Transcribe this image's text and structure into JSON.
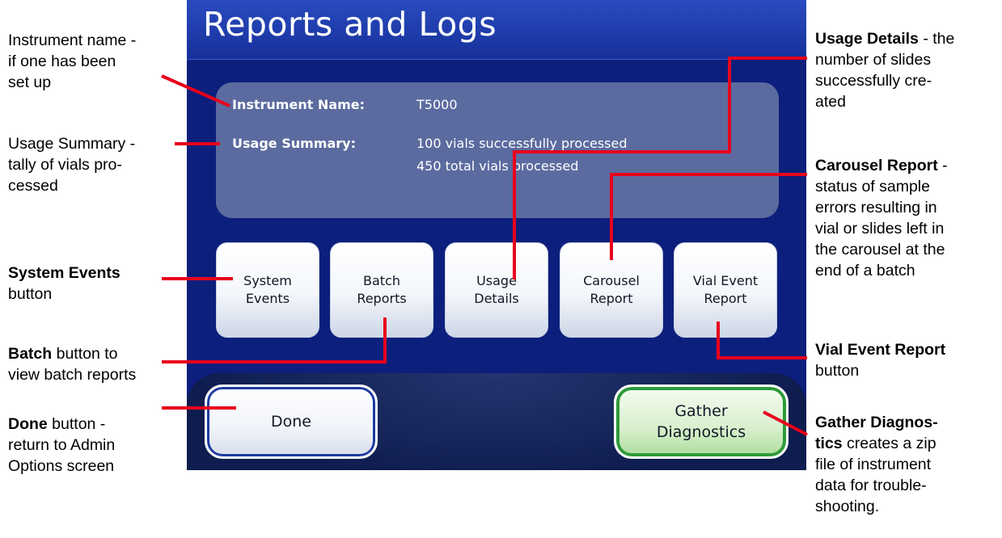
{
  "screen": {
    "title": "Reports and Logs",
    "info": {
      "instrument_name_label": "Instrument Name:",
      "instrument_name_value": "T5000",
      "usage_summary_label": "Usage Summary:",
      "usage_summary_line1": "100 vials successfully processed",
      "usage_summary_line2": "450 total vials processed"
    },
    "buttons": {
      "system_events": "System\nEvents",
      "batch_reports": "Batch\nReports",
      "usage_details": "Usage\nDetails",
      "carousel_report": "Carousel\nReport",
      "vial_event_report": "Vial Event\nReport"
    },
    "done": "Done",
    "gather_diagnostics": "Gather\nDiagnostics"
  },
  "annotations": {
    "instrument_name": {
      "lines": [
        "Instrument name -",
        "if one has been",
        "set up"
      ]
    },
    "usage_summary": {
      "lines": [
        "Usage Summary -",
        "tally of vials pro-",
        "cessed"
      ]
    },
    "system_events": {
      "bold": "System Events",
      "rest": "button"
    },
    "batch": {
      "bold": "Batch",
      "rest1": " button to",
      "rest2": "view batch reports"
    },
    "done": {
      "bold": "Done",
      "rest1": " button -",
      "rest2": "return to Admin",
      "rest3": "Options screen"
    },
    "usage_details": {
      "bold": "Usage Details",
      "rest1": " - the",
      "rest2": "number of slides",
      "rest3": "successfully cre-",
      "rest4": "ated"
    },
    "carousel_report": {
      "bold": "Carousel Report",
      "rest1": " -",
      "rest2": "status of sample",
      "rest3": "errors resulting in",
      "rest4": "vial or slides left in",
      "rest5": "the carousel at the",
      "rest6": "end of a batch"
    },
    "vial_event_report": {
      "bold": "Vial Event Report",
      "rest": "button"
    },
    "gather_diagnostics": {
      "bold1": "Gather Diagnos-",
      "bold2": "tics",
      "rest1": " creates a zip",
      "rest2": "file of instrument",
      "rest3": "data for trouble-",
      "rest4": "shooting."
    }
  },
  "colors": {
    "screen_bg": "#0d1f7c",
    "callout_line": "#e8001c",
    "diagnostics_green": "#2e9a3a"
  }
}
